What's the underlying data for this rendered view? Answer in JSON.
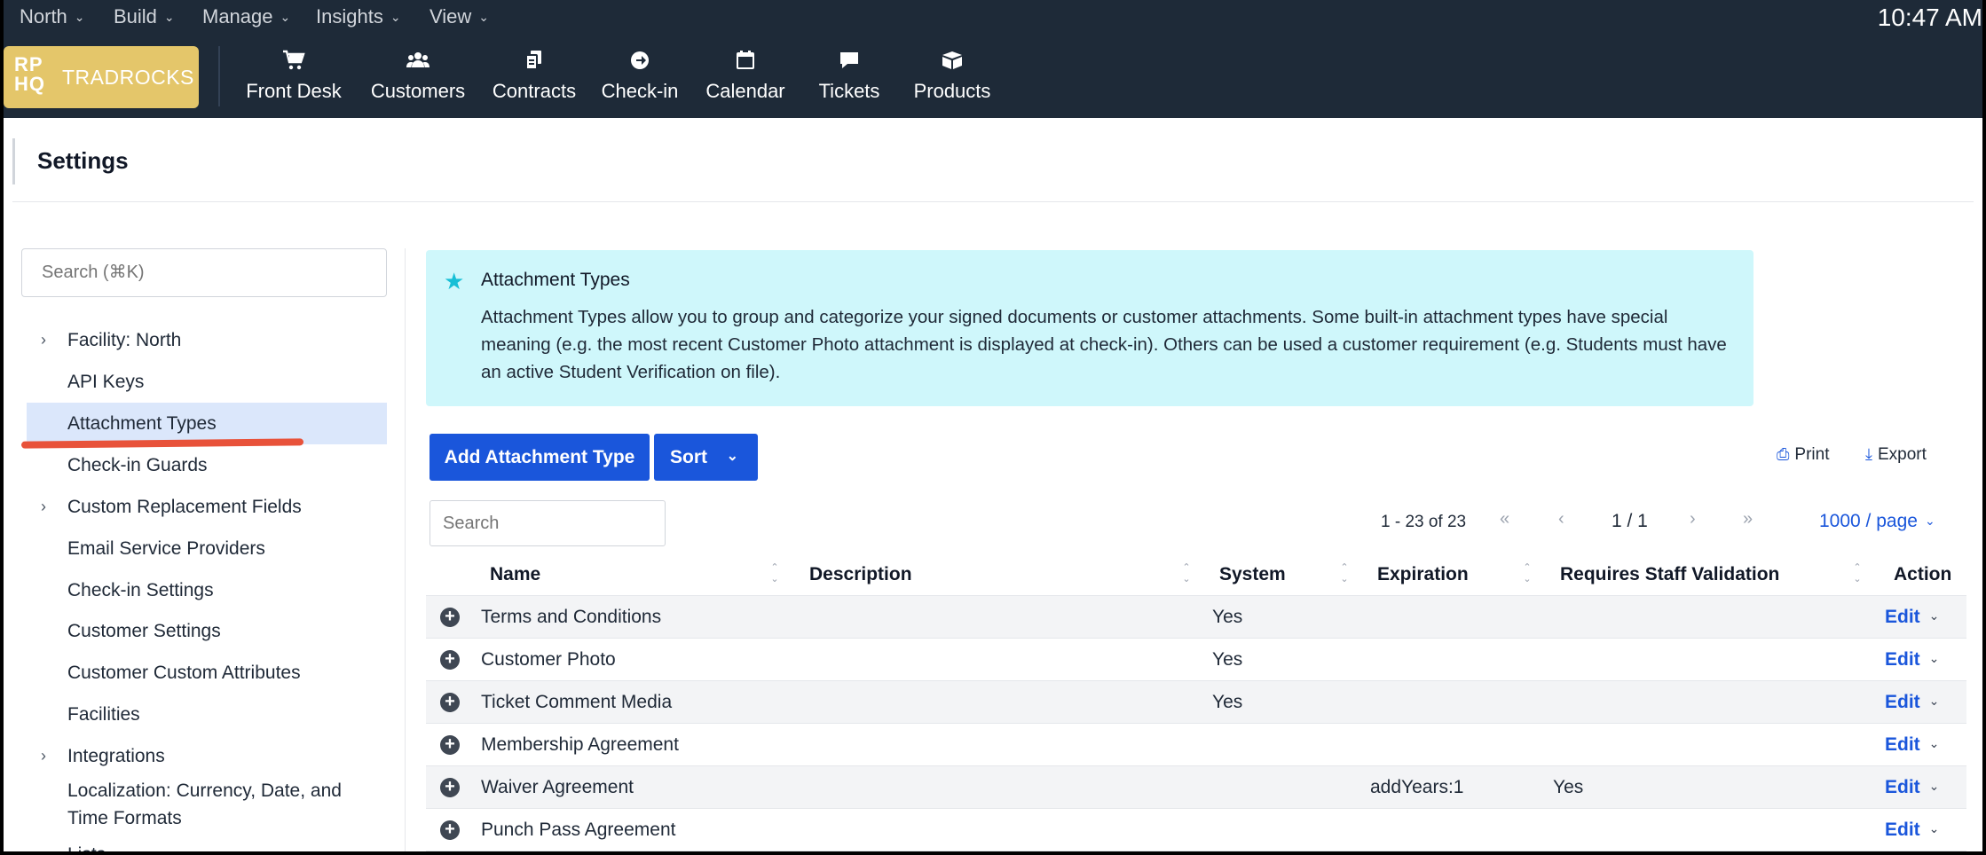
{
  "menubar": {
    "menus": [
      {
        "label": "North"
      },
      {
        "label": "Build"
      },
      {
        "label": "Manage"
      },
      {
        "label": "Insights"
      },
      {
        "label": "View"
      }
    ],
    "clock": "10:47 AM"
  },
  "brand": {
    "monogram_top": "RP",
    "monogram_bottom": "HQ",
    "name": "TRADROCKS",
    "color": "#e4c66a"
  },
  "nav": [
    {
      "label": "Front Desk",
      "icon": "cart-icon"
    },
    {
      "label": "Customers",
      "icon": "users-icon"
    },
    {
      "label": "Contracts",
      "icon": "copy-icon"
    },
    {
      "label": "Check-in",
      "icon": "arrow-circle-icon"
    },
    {
      "label": "Calendar",
      "icon": "calendar-icon"
    },
    {
      "label": "Tickets",
      "icon": "comment-icon"
    },
    {
      "label": "Products",
      "icon": "box-icon"
    }
  ],
  "settings": {
    "title": "Settings"
  },
  "sidebar": {
    "search_placeholder": "Search (⌘K)",
    "items": [
      {
        "label": "Facility: North",
        "expandable": true
      },
      {
        "label": "API Keys"
      },
      {
        "label": "Attachment Types",
        "active": true
      },
      {
        "label": "Check-in Guards"
      },
      {
        "label": "Custom Replacement Fields",
        "expandable": true
      },
      {
        "label": "Email Service Providers"
      },
      {
        "label": "Check-in Settings"
      },
      {
        "label": "Customer Settings"
      },
      {
        "label": "Customer Custom Attributes"
      },
      {
        "label": "Facilities"
      },
      {
        "label": "Integrations",
        "expandable": true
      },
      {
        "label": "Localization: Currency, Date, and Time Formats"
      },
      {
        "label": "Lists",
        "expandable": true
      }
    ]
  },
  "callout": {
    "title": "Attachment Types",
    "body": "Attachment Types allow you to group and categorize your signed documents or customer attachments. Some built-in attachment types have special meaning (e.g. the most recent Customer Photo attachment is displayed at check-in). Others can be used a customer requirement (e.g. Students must have an active Student Verification on file).",
    "background": "#cff7fb"
  },
  "toolbar": {
    "add_label": "Add Attachment Type",
    "sort_label": "Sort",
    "print_label": "Print",
    "export_label": "Export",
    "accent": "#1a56db"
  },
  "table": {
    "search_placeholder": "Search",
    "range": "1 - 23 of 23",
    "page": "1 / 1",
    "page_size": "1000 / page",
    "columns": [
      "Name",
      "Description",
      "System",
      "Expiration",
      "Requires Staff Validation",
      "Action"
    ],
    "rows": [
      {
        "name": "Terms and Conditions",
        "description": "",
        "system": "Yes",
        "expiration": "",
        "staff_validation": "",
        "action": "Edit"
      },
      {
        "name": "Customer Photo",
        "description": "",
        "system": "Yes",
        "expiration": "",
        "staff_validation": "",
        "action": "Edit"
      },
      {
        "name": "Ticket Comment Media",
        "description": "",
        "system": "Yes",
        "expiration": "",
        "staff_validation": "",
        "action": "Edit"
      },
      {
        "name": "Membership Agreement",
        "description": "",
        "system": "",
        "expiration": "",
        "staff_validation": "",
        "action": "Edit"
      },
      {
        "name": "Waiver Agreement",
        "description": "",
        "system": "",
        "expiration": "addYears:1",
        "staff_validation": "Yes",
        "action": "Edit"
      },
      {
        "name": "Punch Pass Agreement",
        "description": "",
        "system": "",
        "expiration": "",
        "staff_validation": "",
        "action": "Edit"
      }
    ]
  }
}
